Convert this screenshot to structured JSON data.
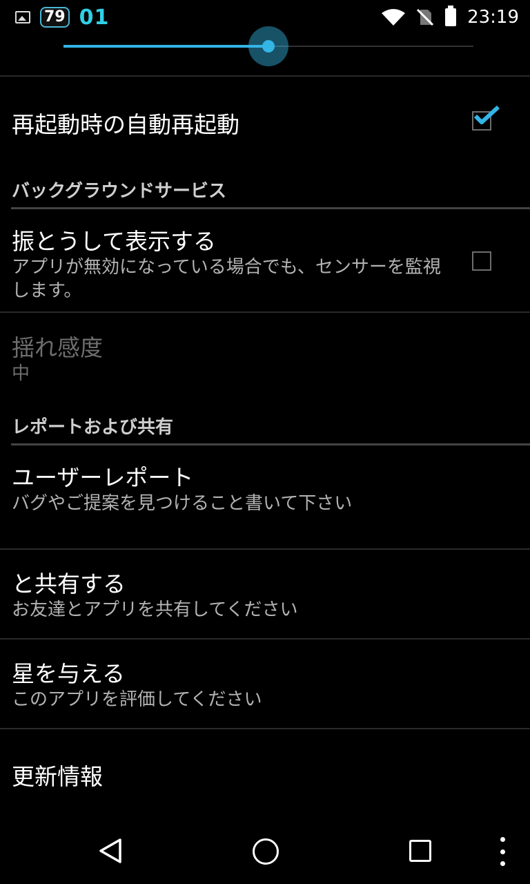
{
  "status_bar": {
    "badge_number": "79",
    "counter": "01",
    "time": "23:19",
    "icons": [
      "image-icon",
      "wifi-icon",
      "no-sim-icon",
      "battery-icon"
    ]
  },
  "slider": {
    "value_fraction": 0.5,
    "accent_color": "#33b5e5"
  },
  "settings": {
    "auto_restart": {
      "title": "再起動時の自動再起動",
      "checked": true
    },
    "background_header": "バックグラウンドサービス",
    "shake_display": {
      "title": "振とうして表示する",
      "summary": "アプリが無効になっている場合でも、センサーを監視します。",
      "checked": false
    },
    "shake_sensitivity": {
      "title": "揺れ感度",
      "value": "中"
    },
    "report_header": "レポートおよび共有",
    "user_report": {
      "title": "ユーザーレポート",
      "summary": "バグやご提案を見つけること書いて下さい"
    },
    "share": {
      "title": "と共有する",
      "summary": "お友達とアプリを共有してください"
    },
    "rate": {
      "title": "星を与える",
      "summary": "このアプリを評価してください"
    },
    "changelog": {
      "title": "更新情報"
    }
  },
  "nav_bar": {
    "icons": [
      "back-icon",
      "home-icon",
      "recent-apps-icon",
      "overflow-menu-icon"
    ]
  }
}
